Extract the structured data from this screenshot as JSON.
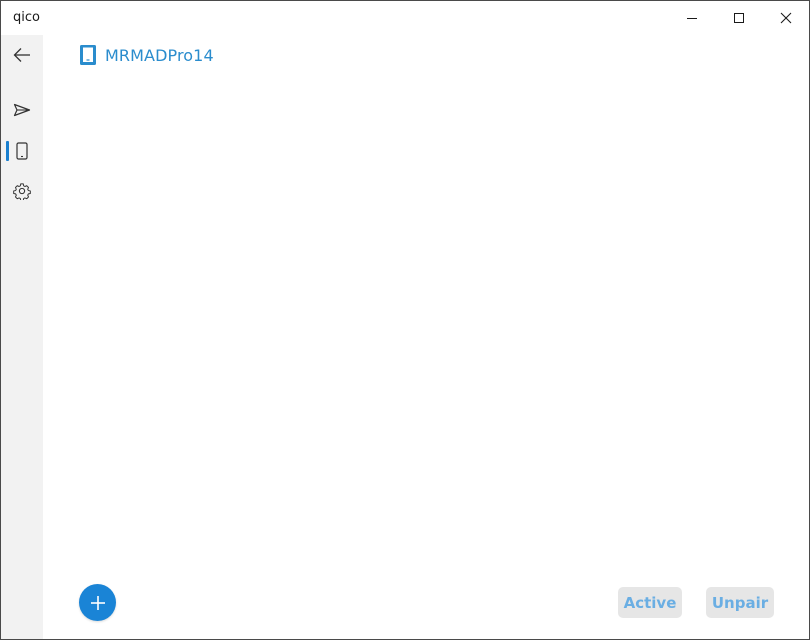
{
  "window": {
    "title": "qico"
  },
  "sidebar": {
    "items": [
      {
        "id": "back",
        "icon": "back-arrow-icon"
      },
      {
        "id": "send",
        "icon": "send-icon"
      },
      {
        "id": "devices",
        "icon": "phone-device-icon",
        "selected": true
      },
      {
        "id": "settings",
        "icon": "gear-icon"
      }
    ]
  },
  "main": {
    "device": {
      "name": "MRMADPro14",
      "icon": "phone-device-icon"
    }
  },
  "actions": {
    "add_icon": "plus-icon",
    "active_label": "Active",
    "unpair_label": "Unpair"
  },
  "colors": {
    "accent": "#1a84d6",
    "device_text": "#2a8ccd",
    "button_text": "#6aaee3",
    "button_bg": "#e6e6e6",
    "rail_bg": "#f2f2f2"
  }
}
